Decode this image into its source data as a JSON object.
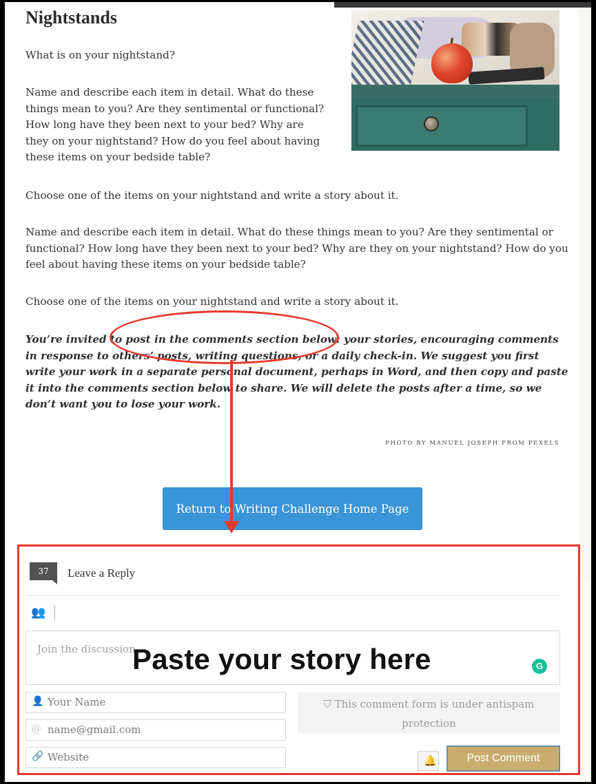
{
  "article": {
    "title": "Nightstands",
    "intro": "What is on your nightstand?",
    "para_a": "Name and describe each item in detail. What do these things mean to you? Are they sentimental or functional? How long have they been next to your bed? Why are they on your nightstand? How do you feel about having these items on your bedside table?",
    "para_b": "Choose one of the items on your nightstand and write a story about it.",
    "para_c": "Name and describe each item in detail. What do these things mean to you? Are they sentimental or functional? How long have they been next to your bed? Why are they on your nightstand? How do you feel about having these items on your bedside table?",
    "para_d": "Choose one of the items on your nightstand and write a story about it.",
    "invite": "You’re invited to post in the comments section below: your stories, encouraging comments in response to others’ posts, writing questions, or a daily check-in. We suggest you first write your work in a separate personal document, perhaps in Word, and then copy and paste it into the comments section below to share. We will delete the posts after a time, so we don’t want you to lose your work.",
    "photo_credit": "Photo by Manuel Joseph from Pexels"
  },
  "cta": {
    "label": "Return to Writing Challenge Home Page"
  },
  "comments": {
    "count": "37",
    "heading": "Leave a Reply",
    "textarea_placeholder": "Join the discussion",
    "overlay_label": "Paste your story here",
    "grammarly_letter": "G",
    "name_placeholder": "Your Name",
    "email_placeholder": "name@gmail.com",
    "website_placeholder": "Website",
    "antispam_text": "This comment form is under antispam protection",
    "post_label": "Post Comment"
  },
  "icons": {
    "user": "👤",
    "user_settings": "👥",
    "email": "@",
    "link": "🔗",
    "shield": "⛉",
    "bell": "🔔"
  },
  "colors": {
    "cta_blue": "#3b94d6",
    "annotation_red": "#e53a2c",
    "post_gold": "#c9ad6f",
    "grammarly_green": "#15c39a"
  }
}
